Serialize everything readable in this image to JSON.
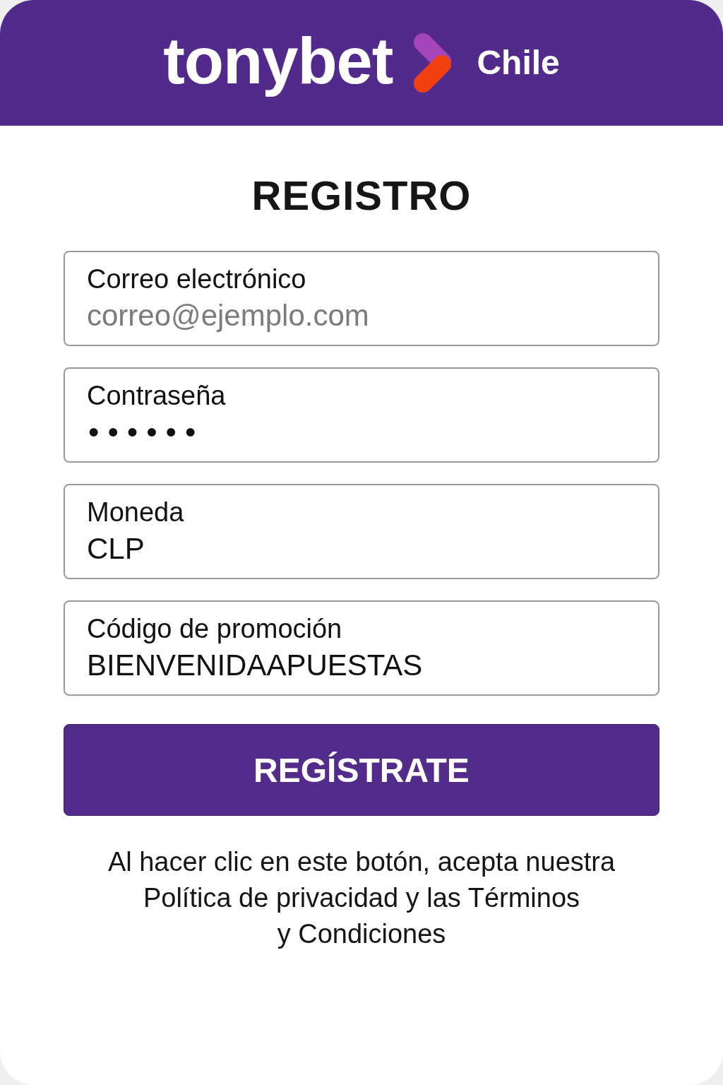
{
  "header": {
    "logo_text": "tonybet",
    "region": "Chile"
  },
  "title": "REGISTRO",
  "fields": [
    {
      "kind": "text",
      "label": "Correo electrónico",
      "placeholder": "correo@ejemplo.com"
    },
    {
      "kind": "password",
      "label": "Contraseña",
      "value": "••••••"
    },
    {
      "kind": "text",
      "label": "Moneda",
      "value": "CLP"
    },
    {
      "kind": "text",
      "label": "Código de promoción",
      "value": "BIENVENIDAAPUESTAS"
    }
  ],
  "submit_button": "REGÍSTRATE",
  "terms": {
    "lines": [
      "Al hacer clic en este botón, acepta nuestra",
      "Política de privacidad y las Términos",
      "y Condiciones"
    ]
  }
}
